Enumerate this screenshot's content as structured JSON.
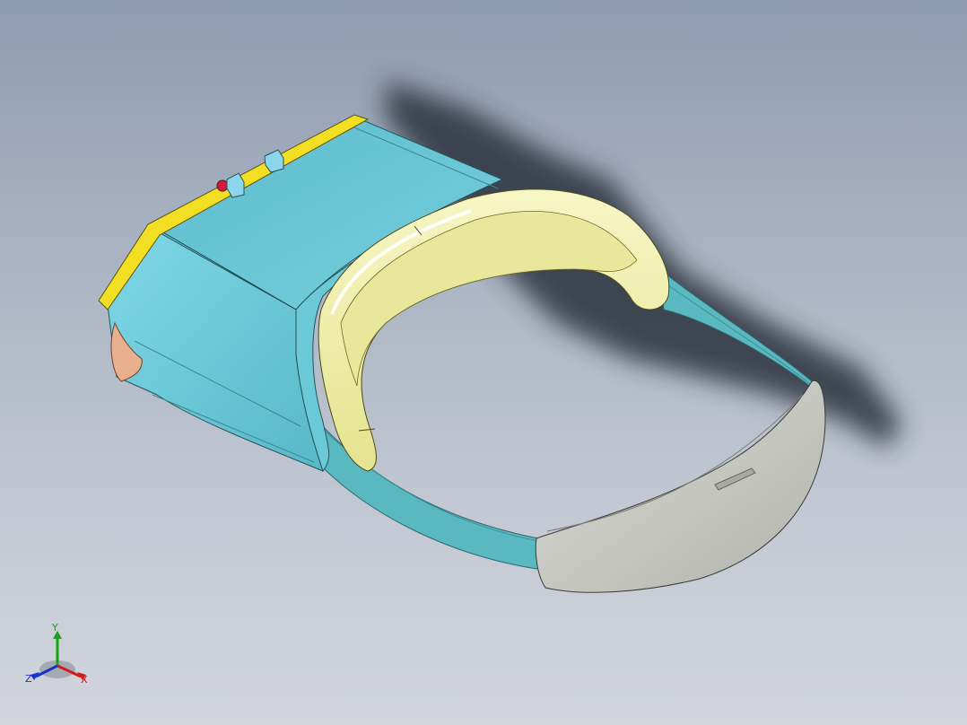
{
  "viewport": {
    "background_top": "#8e9cb1",
    "background_bottom": "#d2d5dc"
  },
  "model": {
    "body_color": "#6cc8d6",
    "strap_color": "#5ebcc4",
    "cushion_color": "#f1f0a6",
    "trim_color": "#f2de22",
    "back_pad_color": "#cdcdc6",
    "front_pad_color": "#e8b08f",
    "led_red": "#d51b3a",
    "button_blue": "#8dd5ea"
  },
  "triad": {
    "y_label": "Y",
    "x_label": "X",
    "z_label": "Z",
    "y_color": "#17a317",
    "x_color": "#d11a1a",
    "z_color": "#1b32c8"
  }
}
